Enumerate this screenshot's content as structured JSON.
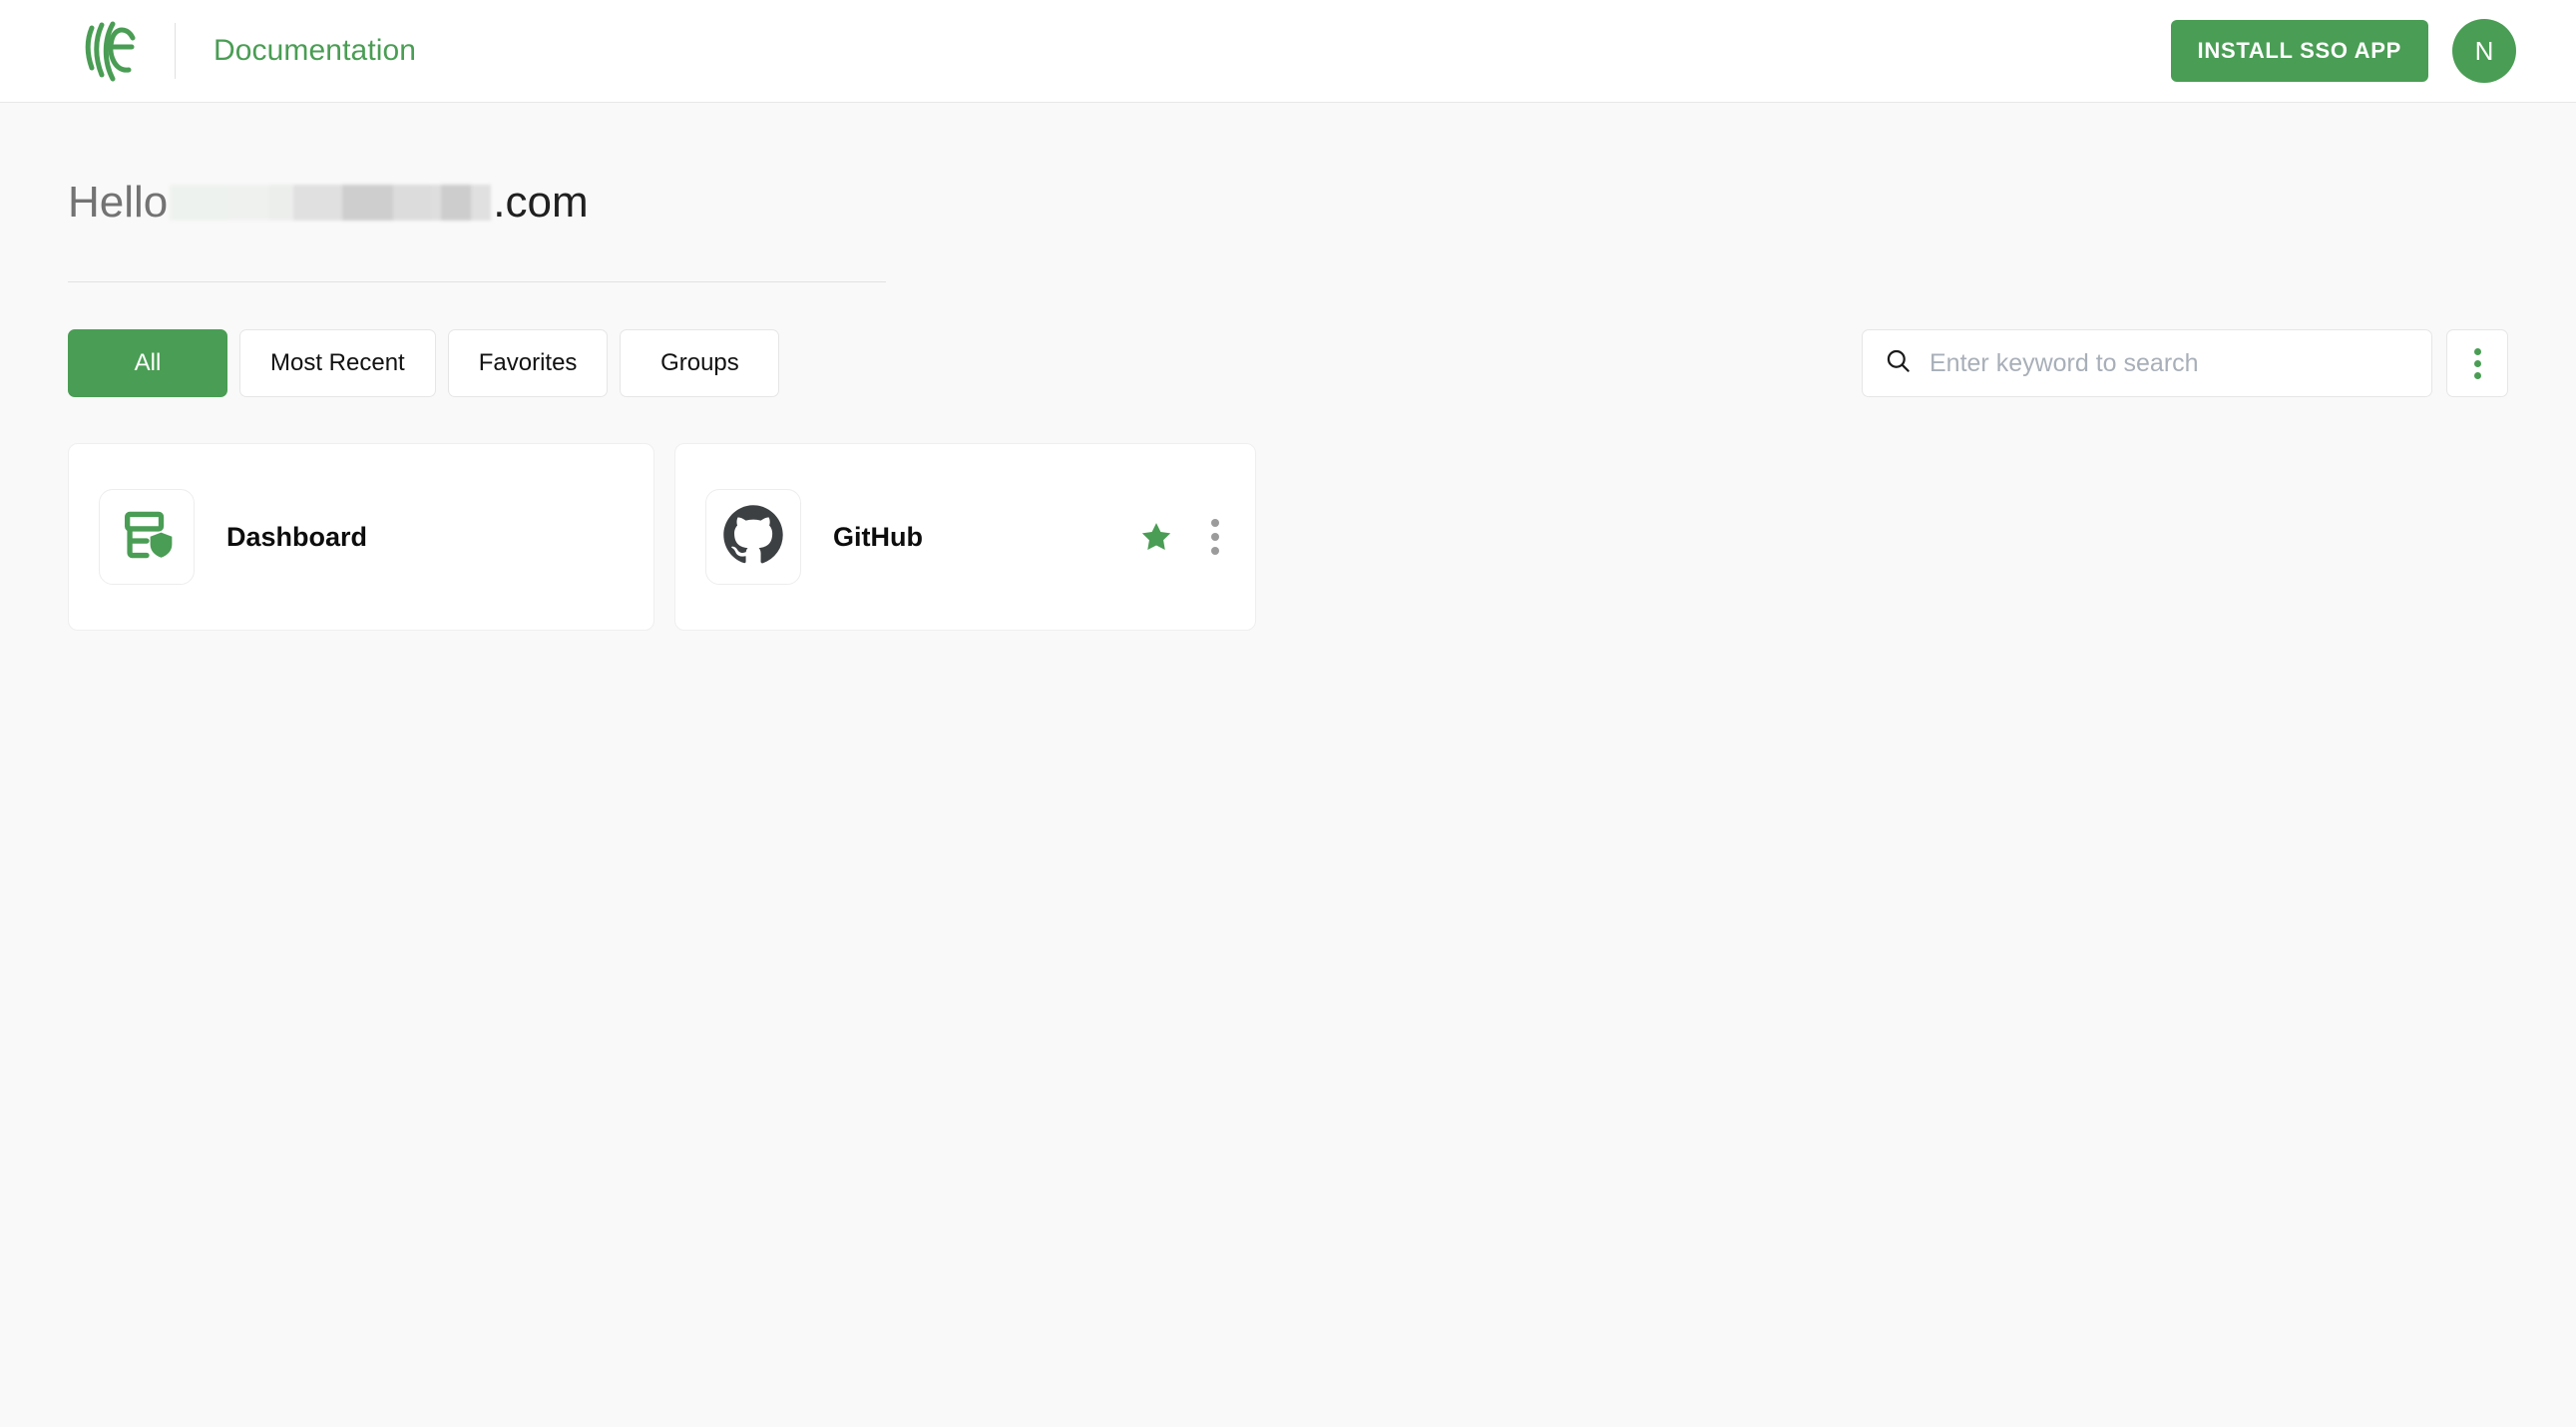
{
  "header": {
    "logo_icon": "nice-arcs-logo",
    "title": "Documentation",
    "install_button": "INSTALL SSO APP",
    "avatar_initial": "N",
    "accent_color": "#4a9d54"
  },
  "greeting": {
    "hello": "Hello",
    "redacted_name": "",
    "domain_suffix": ".com"
  },
  "filters": {
    "tabs": [
      {
        "label": "All",
        "active": true
      },
      {
        "label": "Most Recent",
        "active": false
      },
      {
        "label": "Favorites",
        "active": false
      },
      {
        "label": "Groups",
        "active": false
      }
    ],
    "overflow_icon": "kebab-menu-icon"
  },
  "search": {
    "icon": "search-icon",
    "placeholder": "Enter keyword to search",
    "value": ""
  },
  "apps": [
    {
      "name": "Dashboard",
      "icon": "dashboard-shield-icon",
      "favorite": false,
      "has_menu": false
    },
    {
      "name": "GitHub",
      "icon": "github-icon",
      "favorite": true,
      "has_menu": true
    }
  ]
}
